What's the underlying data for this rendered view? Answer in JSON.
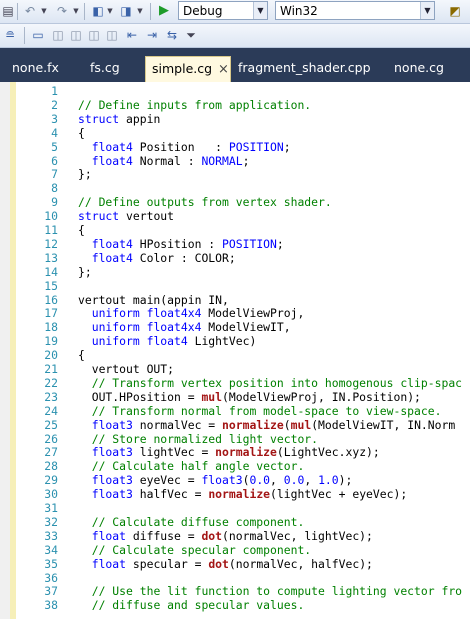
{
  "toolbar": {
    "config_combo": "Debug",
    "platform_combo": "Win32"
  },
  "tabs": [
    {
      "label": "none.fx"
    },
    {
      "label": "fs.cg"
    },
    {
      "label": "simple.cg",
      "close": "×"
    },
    {
      "label": "fragment_shader.cpp"
    },
    {
      "label": "none.cg"
    }
  ],
  "editor": {
    "lines": [
      {
        "n": "1",
        "tokens": []
      },
      {
        "n": "2",
        "tokens": [
          {
            "t": "// Define inputs from application.",
            "c": "cm"
          }
        ]
      },
      {
        "n": "3",
        "tokens": [
          {
            "t": "struct",
            "c": "kw"
          },
          {
            "t": " appin"
          }
        ]
      },
      {
        "n": "4",
        "tokens": [
          {
            "t": "{"
          }
        ]
      },
      {
        "n": "5",
        "tokens": [
          {
            "t": "  "
          },
          {
            "t": "float4",
            "c": "kw"
          },
          {
            "t": " Position   : "
          },
          {
            "t": "POSITION",
            "c": "kw"
          },
          {
            "t": ";"
          }
        ]
      },
      {
        "n": "6",
        "tokens": [
          {
            "t": "  "
          },
          {
            "t": "float4",
            "c": "kw"
          },
          {
            "t": " Normal : "
          },
          {
            "t": "NORMAL",
            "c": "kw"
          },
          {
            "t": ";"
          }
        ]
      },
      {
        "n": "7",
        "tokens": [
          {
            "t": "};"
          }
        ]
      },
      {
        "n": "8",
        "tokens": []
      },
      {
        "n": "9",
        "tokens": [
          {
            "t": "// Define outputs from vertex shader.",
            "c": "cm"
          }
        ]
      },
      {
        "n": "10",
        "tokens": [
          {
            "t": "struct",
            "c": "kw"
          },
          {
            "t": " vertout"
          }
        ]
      },
      {
        "n": "11",
        "tokens": [
          {
            "t": "{"
          }
        ]
      },
      {
        "n": "12",
        "tokens": [
          {
            "t": "  "
          },
          {
            "t": "float4",
            "c": "kw"
          },
          {
            "t": " HPosition : "
          },
          {
            "t": "POSITION",
            "c": "kw"
          },
          {
            "t": ";"
          }
        ]
      },
      {
        "n": "13",
        "tokens": [
          {
            "t": "  "
          },
          {
            "t": "float4",
            "c": "kw"
          },
          {
            "t": " Color : COLOR;"
          }
        ]
      },
      {
        "n": "14",
        "tokens": [
          {
            "t": "};"
          }
        ]
      },
      {
        "n": "15",
        "tokens": []
      },
      {
        "n": "16",
        "tokens": [
          {
            "t": "vertout main(appin IN,"
          }
        ]
      },
      {
        "n": "17",
        "tokens": [
          {
            "t": "  "
          },
          {
            "t": "uniform float4x4",
            "c": "kw"
          },
          {
            "t": " ModelViewProj,"
          }
        ]
      },
      {
        "n": "18",
        "tokens": [
          {
            "t": "  "
          },
          {
            "t": "uniform float4x4",
            "c": "kw"
          },
          {
            "t": " ModelViewIT,"
          }
        ]
      },
      {
        "n": "19",
        "tokens": [
          {
            "t": "  "
          },
          {
            "t": "uniform float4",
            "c": "kw"
          },
          {
            "t": " LightVec)"
          }
        ]
      },
      {
        "n": "20",
        "tokens": [
          {
            "t": "{"
          }
        ]
      },
      {
        "n": "21",
        "tokens": [
          {
            "t": "  vertout OUT;"
          }
        ]
      },
      {
        "n": "22",
        "tokens": [
          {
            "t": "  "
          },
          {
            "t": "// Transform vertex position into homogenous clip-spac",
            "c": "cm"
          }
        ]
      },
      {
        "n": "23",
        "tokens": [
          {
            "t": "  OUT.HPosition = "
          },
          {
            "t": "mul",
            "c": "fn"
          },
          {
            "t": "(ModelViewProj, IN.Position);"
          }
        ]
      },
      {
        "n": "24",
        "tokens": [
          {
            "t": "  "
          },
          {
            "t": "// Transform normal from model-space to view-space.",
            "c": "cm"
          }
        ]
      },
      {
        "n": "25",
        "tokens": [
          {
            "t": "  "
          },
          {
            "t": "float3",
            "c": "kw"
          },
          {
            "t": " normalVec = "
          },
          {
            "t": "normalize",
            "c": "fn"
          },
          {
            "t": "("
          },
          {
            "t": "mul",
            "c": "fn"
          },
          {
            "t": "(ModelViewIT, IN.Norm"
          }
        ]
      },
      {
        "n": "26",
        "tokens": [
          {
            "t": "  "
          },
          {
            "t": "// Store normalized light vector.",
            "c": "cm"
          }
        ]
      },
      {
        "n": "27",
        "tokens": [
          {
            "t": "  "
          },
          {
            "t": "float3",
            "c": "kw"
          },
          {
            "t": " lightVec = "
          },
          {
            "t": "normalize",
            "c": "fn"
          },
          {
            "t": "(LightVec.xyz);"
          }
        ]
      },
      {
        "n": "28",
        "tokens": [
          {
            "t": "  "
          },
          {
            "t": "// Calculate half angle vector.",
            "c": "cm"
          }
        ]
      },
      {
        "n": "29",
        "tokens": [
          {
            "t": "  "
          },
          {
            "t": "float3",
            "c": "kw"
          },
          {
            "t": " eyeVec = "
          },
          {
            "t": "float3",
            "c": "kw"
          },
          {
            "t": "("
          },
          {
            "t": "0.0",
            "c": "kw"
          },
          {
            "t": ", "
          },
          {
            "t": "0.0",
            "c": "kw"
          },
          {
            "t": ", "
          },
          {
            "t": "1.0",
            "c": "kw"
          },
          {
            "t": ");"
          }
        ]
      },
      {
        "n": "30",
        "tokens": [
          {
            "t": "  "
          },
          {
            "t": "float3",
            "c": "kw"
          },
          {
            "t": " halfVec = "
          },
          {
            "t": "normalize",
            "c": "fn"
          },
          {
            "t": "(lightVec + eyeVec);"
          }
        ]
      },
      {
        "n": "31",
        "tokens": []
      },
      {
        "n": "32",
        "tokens": [
          {
            "t": "  "
          },
          {
            "t": "// Calculate diffuse component.",
            "c": "cm"
          }
        ]
      },
      {
        "n": "33",
        "tokens": [
          {
            "t": "  "
          },
          {
            "t": "float",
            "c": "kw"
          },
          {
            "t": " diffuse = "
          },
          {
            "t": "dot",
            "c": "fn"
          },
          {
            "t": "(normalVec, lightVec);"
          }
        ]
      },
      {
        "n": "34",
        "tokens": [
          {
            "t": "  "
          },
          {
            "t": "// Calculate specular component.",
            "c": "cm"
          }
        ]
      },
      {
        "n": "35",
        "tokens": [
          {
            "t": "  "
          },
          {
            "t": "float",
            "c": "kw"
          },
          {
            "t": " specular = "
          },
          {
            "t": "dot",
            "c": "fn"
          },
          {
            "t": "(normalVec, halfVec);"
          }
        ]
      },
      {
        "n": "36",
        "tokens": []
      },
      {
        "n": "37",
        "tokens": [
          {
            "t": "  "
          },
          {
            "t": "// Use the lit function to compute lighting vector fro",
            "c": "cm"
          }
        ]
      },
      {
        "n": "38",
        "tokens": [
          {
            "t": "  "
          },
          {
            "t": "// diffuse and specular values.",
            "c": "cm"
          }
        ]
      }
    ]
  }
}
